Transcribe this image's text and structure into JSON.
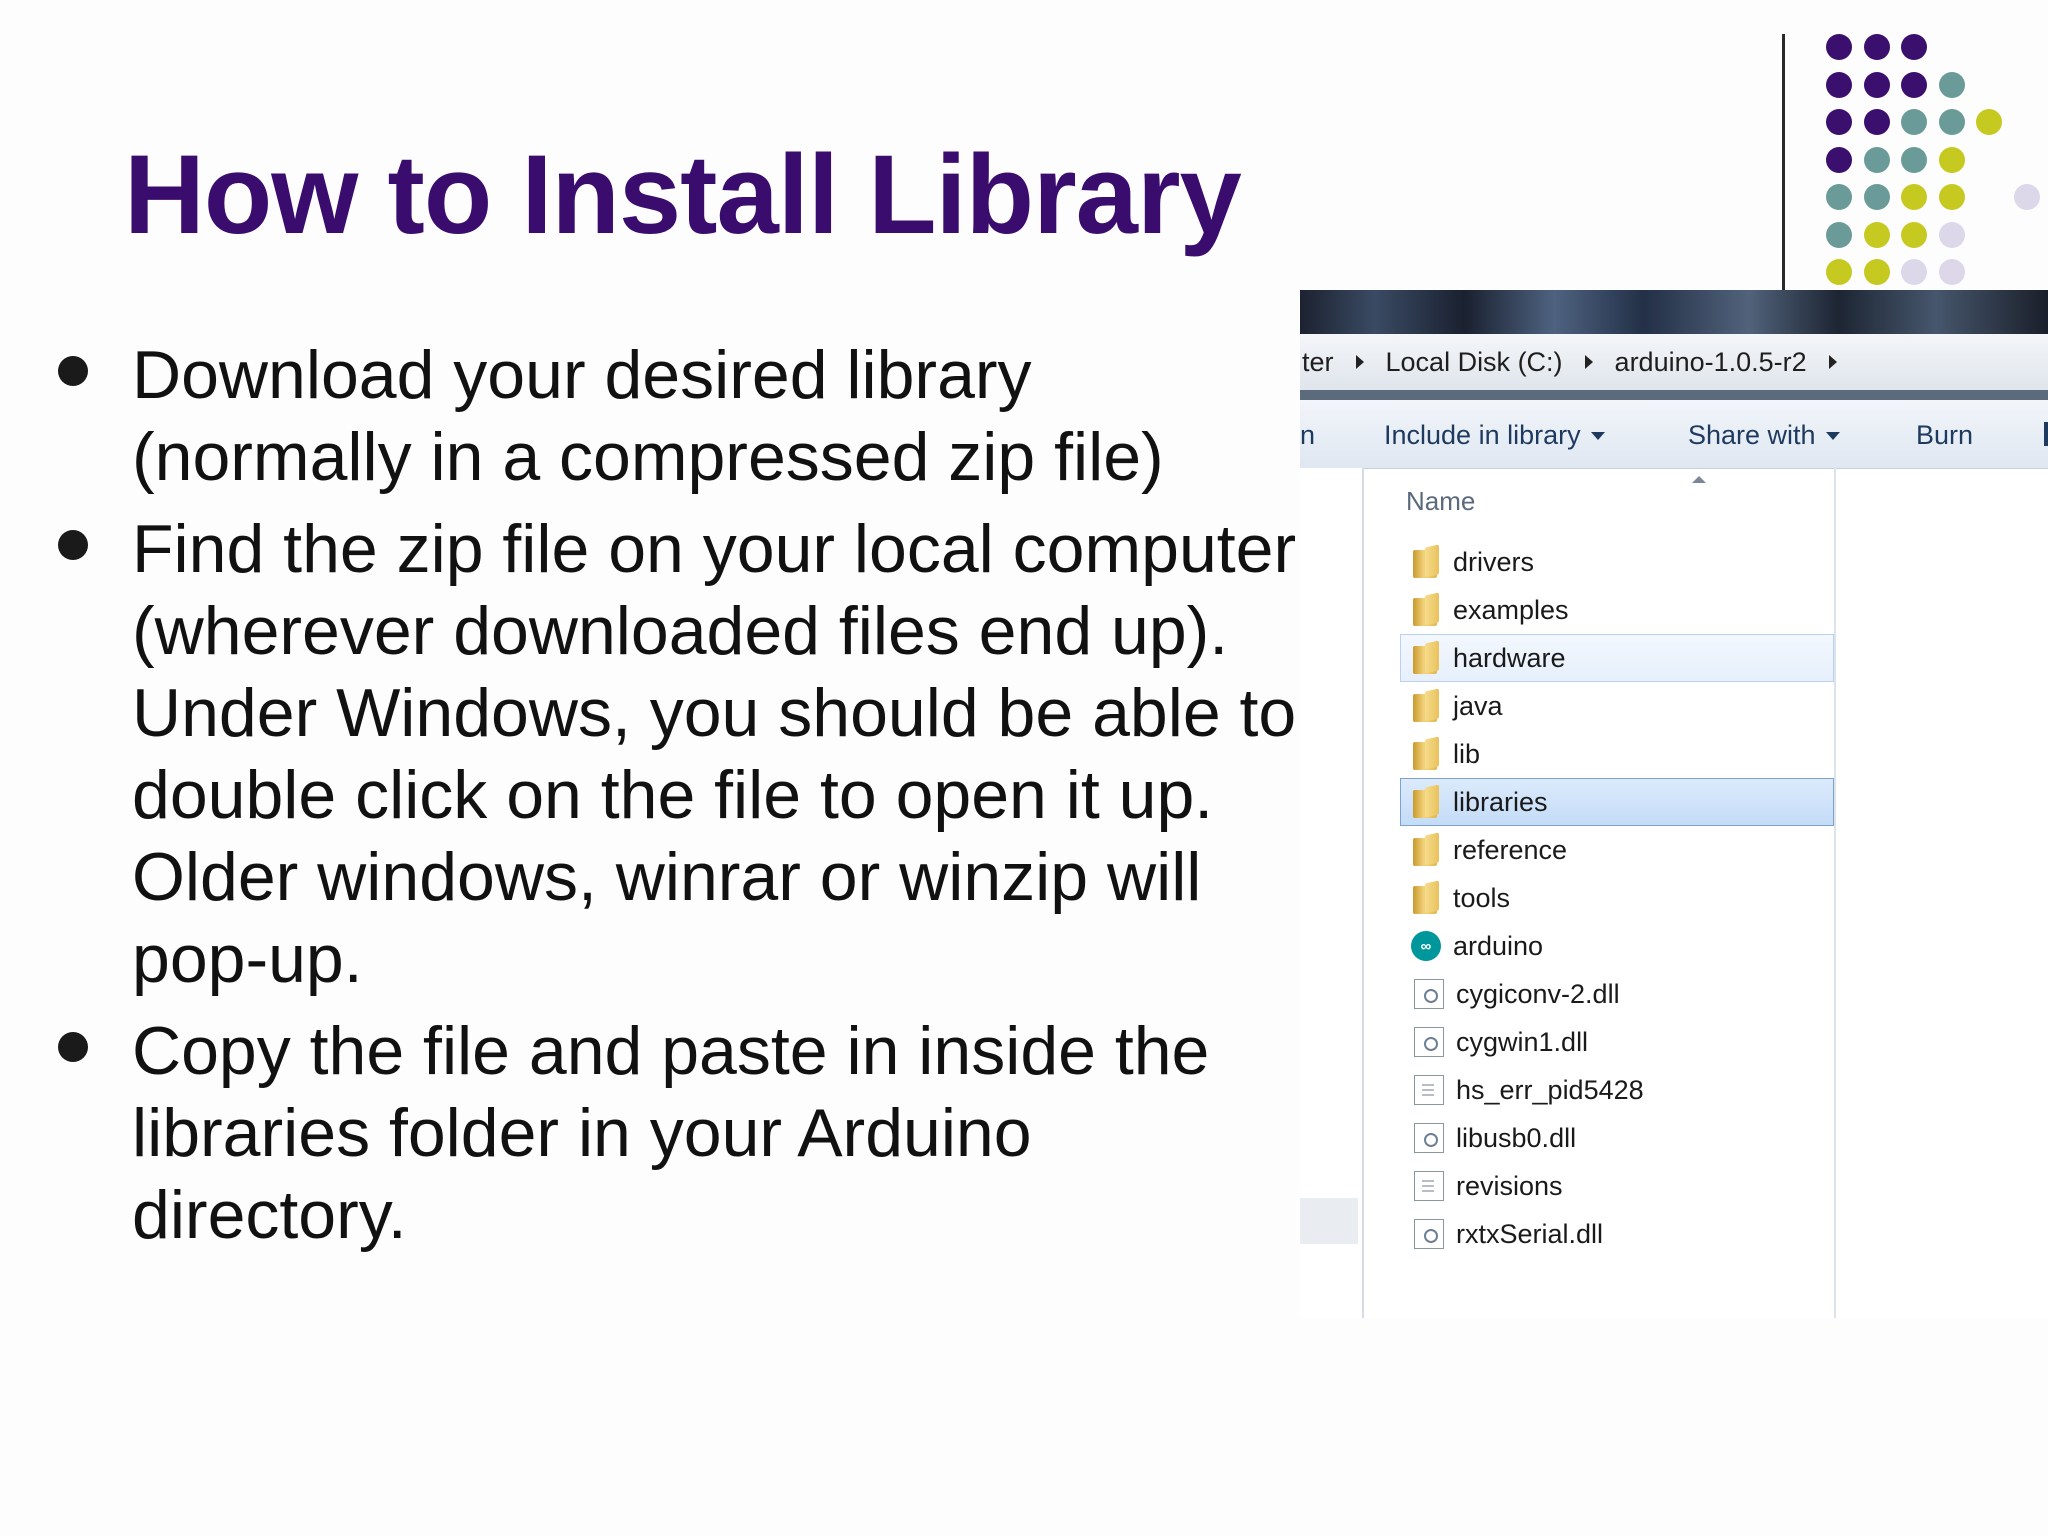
{
  "slide": {
    "title": "How to Install Library",
    "bullets": [
      "Download your desired library\n(normally in a compressed zip file)",
      "Find the zip file on your local computer\n(wherever downloaded files end up).\nUnder Windows, you should be able to\ndouble click on the file to open it up.\nOlder windows, winrar or winzip will\npop-up.",
      "Copy the file and paste in inside the\nlibraries folder in your Arduino\ndirectory."
    ]
  },
  "colors": {
    "title": "#3a0c6e",
    "dot_purple": "#3b0f6d",
    "dot_teal": "#6b9b99",
    "dot_yellow": "#c6c91f",
    "dot_lavender": "#dcd8ea"
  },
  "dot_grid": [
    [
      "purple",
      "purple",
      "purple",
      "",
      "",
      ""
    ],
    [
      "purple",
      "purple",
      "purple",
      "teal",
      "",
      ""
    ],
    [
      "purple",
      "purple",
      "teal",
      "teal",
      "yellow",
      ""
    ],
    [
      "purple",
      "teal",
      "teal",
      "yellow",
      "",
      ""
    ],
    [
      "teal",
      "teal",
      "yellow",
      "yellow",
      "lavender",
      ""
    ],
    [
      "teal",
      "yellow",
      "yellow",
      "lavender",
      "",
      ""
    ],
    [
      "yellow",
      "yellow",
      "lavender",
      "lavender",
      "",
      ""
    ]
  ],
  "explorer": {
    "breadcrumb": [
      "ter",
      "Local Disk (C:)",
      "arduino-1.0.5-r2"
    ],
    "toolbar": {
      "partial_left": "n",
      "include_in_library": "Include in library",
      "share_with": "Share with",
      "burn": "Burn"
    },
    "column_header": "Name",
    "files": [
      {
        "name": "drivers",
        "icon": "folder-icon",
        "state": ""
      },
      {
        "name": "examples",
        "icon": "folder-icon",
        "state": ""
      },
      {
        "name": "hardware",
        "icon": "folder-icon",
        "state": "hover"
      },
      {
        "name": "java",
        "icon": "folder-icon",
        "state": ""
      },
      {
        "name": "lib",
        "icon": "folder-icon",
        "state": ""
      },
      {
        "name": "libraries",
        "icon": "folder-icon",
        "state": "selected"
      },
      {
        "name": "reference",
        "icon": "folder-icon",
        "state": ""
      },
      {
        "name": "tools",
        "icon": "folder-icon",
        "state": ""
      },
      {
        "name": "arduino",
        "icon": "arduino-app-icon",
        "state": ""
      },
      {
        "name": "cygiconv-2.dll",
        "icon": "dll-file-icon",
        "state": ""
      },
      {
        "name": "cygwin1.dll",
        "icon": "dll-file-icon",
        "state": ""
      },
      {
        "name": "hs_err_pid5428",
        "icon": "text-file-icon",
        "state": ""
      },
      {
        "name": "libusb0.dll",
        "icon": "dll-file-icon",
        "state": ""
      },
      {
        "name": "revisions",
        "icon": "text-file-icon",
        "state": ""
      },
      {
        "name": "rxtxSerial.dll",
        "icon": "dll-file-icon",
        "state": ""
      }
    ]
  }
}
